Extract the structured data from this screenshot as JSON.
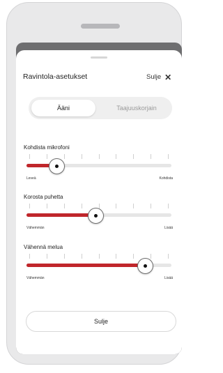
{
  "sheet": {
    "title": "Ravintola-asetukset",
    "close_label": "Sulje"
  },
  "tabs": [
    {
      "label": "Ääni",
      "active": true
    },
    {
      "label": "Taajuuskorjain",
      "active": false
    }
  ],
  "sliders": [
    {
      "label": "Kohdista mikrofoni",
      "min_label": "Leveä",
      "max_label": "Kohdista",
      "value_fraction": 0.21
    },
    {
      "label": "Korosta puhetta",
      "min_label": "Vähemmän",
      "max_label": "Lisää",
      "value_fraction": 0.48
    },
    {
      "label": "Vähennä melua",
      "min_label": "Vähemmän",
      "max_label": "Lisää",
      "value_fraction": 0.82
    }
  ],
  "footer": {
    "button_label": "Sulje"
  },
  "colors": {
    "accent": "#c0262b",
    "track": "#e6e6e6"
  }
}
